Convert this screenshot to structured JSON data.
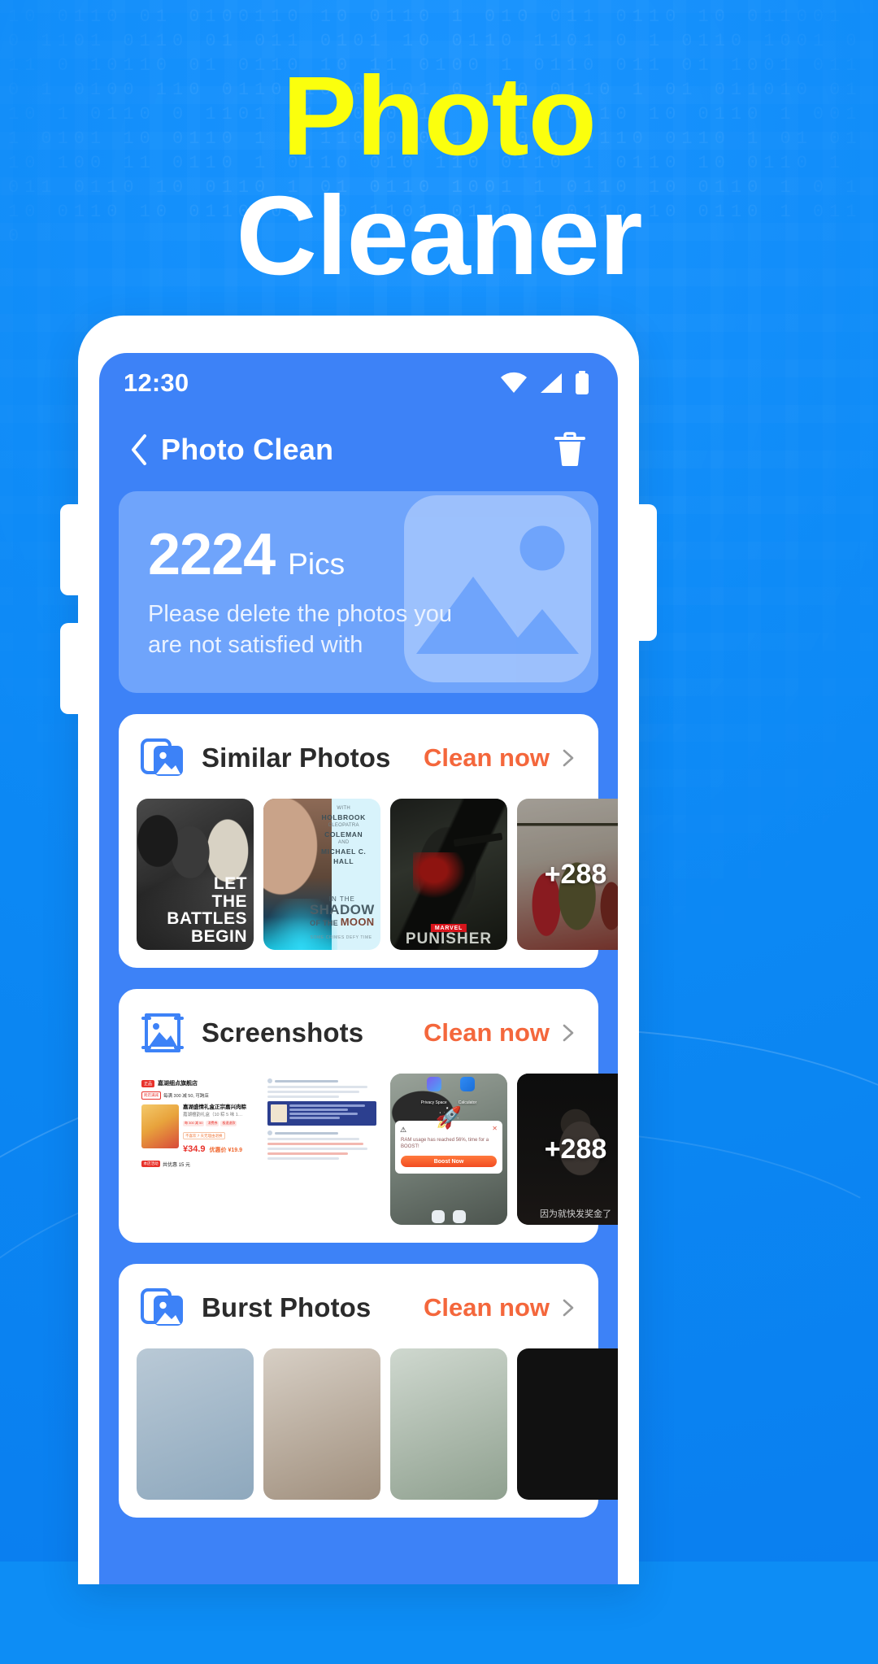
{
  "headline": {
    "line1": "Photo",
    "line2": "Cleaner"
  },
  "colors": {
    "background_blue": "#0d8df5",
    "screen_blue": "#3d82f7",
    "headline_yellow": "#fbff0d",
    "accent_orange": "#f4673c",
    "hero_card_blue": "#6fa4fb"
  },
  "phone": {
    "status_bar": {
      "time": "12:30",
      "icons": [
        "wifi-icon",
        "signal-icon",
        "battery-icon"
      ]
    },
    "nav_bar": {
      "back_icon": "chevron-left-icon",
      "title": "Photo Clean",
      "trash_icon": "trash-icon"
    },
    "hero": {
      "count": "2224",
      "unit": "Pics",
      "description": "Please delete the photos you are not satisfied with",
      "art_icon": "photo-placeholder-icon"
    },
    "sections": [
      {
        "id": "similar-photos",
        "icon": "stacked-photos-icon",
        "title": "Similar Photos",
        "action_label": "Clean now",
        "action_chevron": "chevron-right-icon",
        "thumbs": [
          {
            "kind": "movie-poster",
            "lines": [
              "LET",
              "THE",
              "BATTLES",
              "BEGIN"
            ]
          },
          {
            "kind": "movie-poster",
            "cast": [
              {
                "role": "WITH",
                "name": "HOLBROOK"
              },
              {
                "role": "CLEOPATRA",
                "name": "COLEMAN"
              },
              {
                "role": "AND",
                "name": "MICHAEL C. HALL"
              }
            ],
            "title_small": "IN THE",
            "title_big": "SHADOW",
            "title_sub_pre": "OF THE",
            "title_sub_em": "MOON",
            "tagline": "SOME CRIMES DEFY TIME"
          },
          {
            "kind": "movie-poster",
            "badge": "MARVEL",
            "title": "PUNISHER"
          },
          {
            "kind": "photo",
            "more_badge": "+288"
          }
        ]
      },
      {
        "id": "screenshots",
        "icon": "image-icon",
        "title": "Screenshots",
        "action_label": "Clean now",
        "action_chevron": "chevron-right-icon",
        "thumbs": [
          {
            "kind": "shopping-screenshot",
            "shop_tag": "正品",
            "shop_name": "嘉湖细点旗舰店",
            "coupon_tag": "跨店满减",
            "coupon_text": "每满 300 减 50, 可跨店",
            "product_name": "嘉湖盛情礼盒正宗嘉兴肉粽",
            "product_sub": "嘉湖檀韵礼盒（10 粽 5 味 1…",
            "promo_tags": [
              "每 300 减 50",
              "消费券",
              "极速退款"
            ],
            "return_tag": "不喜欢 7 天无理由退换",
            "price": "¥34.9",
            "price_discount": "优惠价 ¥19.9",
            "footer_tag": "本店活动",
            "footer_text": "共优惠 15 元"
          },
          {
            "kind": "social-feed-screenshot"
          },
          {
            "kind": "boost-dialog-screenshot",
            "apps": [
              "Privacy Space",
              "Calculator"
            ],
            "warning_icon": "warning-icon",
            "close_icon": "close-icon",
            "rocket_icon": "rocket-icon",
            "message": "RAM usage has reached 56%, time for a BOOST!",
            "button_label": "Boost Now"
          },
          {
            "kind": "photo",
            "more_badge": "+288",
            "caption": "因为就快发奖金了"
          }
        ]
      },
      {
        "id": "burst-photos",
        "icon": "stacked-photos-icon",
        "title": "Burst Photos",
        "action_label": "Clean now",
        "action_chevron": "chevron-right-icon",
        "thumbs": [
          {
            "kind": "photo"
          },
          {
            "kind": "photo"
          },
          {
            "kind": "photo"
          },
          {
            "kind": "photo"
          }
        ]
      }
    ]
  },
  "background": {
    "digits": "10 0110 01 0100110 10 0110 1 010 011 0110 10 011001 0 1101 0110 01 011 0101 10 0110 1101 0 1 0110 1001 011 0 10110 01 0110 10 11 0100 1 0110 011 01 1001 0110 1 0100 110 0110 10 01101 0 110 0110 1 01 011010 0110 1 0110 0 1101 01 10 0110 1 011 0110 10 0110 1 0011 0101 10 0110 1 0 11010 0110 10 1 0110 0110 1 01 0110 100 11 0110 1 0110 010 110 0110 1 0110 10 0110 1 011 0110 10 0110 1 01 0110 1001 1 0110 10 0110 1 0 110 0110 10 0110 011 0 1101 0110 1 0110 10 0110 1 0110"
  }
}
